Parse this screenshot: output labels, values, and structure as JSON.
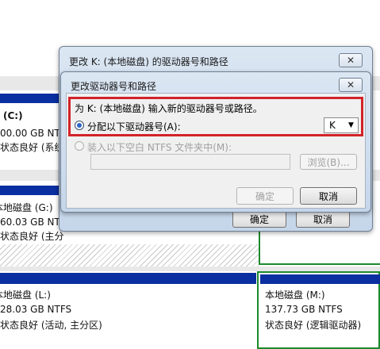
{
  "disks": {
    "c": {
      "title": "(C:)",
      "size": "00.00 GB NTFS",
      "status": "状态良好 (系统,"
    },
    "g": {
      "title": "本地磁盘 (G:)",
      "size": "60.03 GB NTFS",
      "status": "状态良好 (主分"
    },
    "l": {
      "title": "本地磁盘 (L:)",
      "size": "28.03 GB NTFS",
      "status": "状态良好 (活动, 主分区)"
    },
    "m": {
      "title": "本地磁盘 (M:)",
      "size": "137.73 GB NTFS",
      "status": "状态良好 (逻辑驱动器)"
    }
  },
  "outer_dialog": {
    "title": "更改 K: (本地磁盘) 的驱动器号和路径",
    "close": "✕",
    "ok_label": "确定",
    "cancel_label": "取消"
  },
  "inner_dialog": {
    "title": "更改驱动器号和路径",
    "close": "✕",
    "instruction": "为 K: (本地磁盘) 输入新的驱动器号或路径。",
    "assign_option": "分配以下驱动器号(A):",
    "drive_letter": "K",
    "mount_option": "装入以下空白 NTFS 文件夹中(M):",
    "browse_label": "浏览(B)...",
    "ok_label": "确定",
    "cancel_label": "取消"
  },
  "colors": {
    "highlight": "#d2232a",
    "disk_header": "#0a2fa0",
    "logical_frame": "#1c8a2c"
  }
}
